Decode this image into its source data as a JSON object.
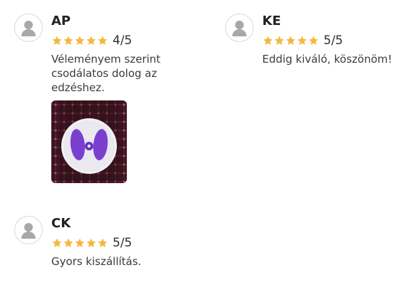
{
  "reviews": [
    {
      "name": "AP",
      "rating_text": "4/5",
      "text": "Véleményem szerint csodálatos dolog az edzéshez.",
      "has_photo": true
    },
    {
      "name": "KE",
      "rating_text": "5/5",
      "text": "Eddig kiváló, köszönöm!",
      "has_photo": false
    },
    {
      "name": "CK",
      "rating_text": "5/5",
      "text": "Gyors kiszállítás.",
      "has_photo": false
    }
  ],
  "icons": {
    "avatar": "user-avatar-icon",
    "star": "star-icon"
  },
  "colors": {
    "star": "#f5b83f",
    "avatar_fill": "#a8a8a8",
    "photo_accent": "#7b3fd0"
  }
}
